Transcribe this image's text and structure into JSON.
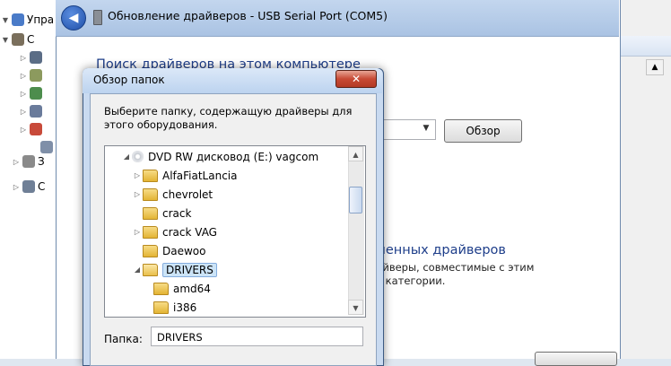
{
  "mmc": {
    "tree_items": [
      {
        "label": "Упра",
        "expander": "▼",
        "icon_color": "#4a7bc8"
      },
      {
        "label": "С",
        "expander": "▼",
        "icon_color": "#7a6f5c"
      },
      {
        "label": "",
        "expander": "▷",
        "icon_color": "#5b6d86"
      },
      {
        "label": "",
        "expander": "▷",
        "icon_color": "#8c9a5e"
      },
      {
        "label": "",
        "expander": "▷",
        "icon_color": "#4d8d4d"
      },
      {
        "label": "",
        "expander": "▷",
        "icon_color": "#6a7b9b"
      },
      {
        "label": "",
        "expander": "▷",
        "icon_color": "#c84a3a"
      },
      {
        "label": "",
        "expander": "",
        "icon_color": "#7f8fa8"
      },
      {
        "label": "З",
        "expander": "▷",
        "icon_color": "#8a8a8a"
      },
      {
        "label": "С",
        "expander": "▷",
        "icon_color": "#6f7f96"
      }
    ],
    "scroll_up_glyph": "▲"
  },
  "wizard": {
    "back_glyph": "◀",
    "title": "Обновление драйверов - USB Serial Port (COM5)",
    "heading": "Поиск драйверов на этом компьютере",
    "combo_arrow": "▼",
    "browse_button": "Обзор",
    "option2_title": "вленных драйверов",
    "option2_desc_1": "райверы, совместимые с этим",
    "option2_desc_2": "ке категории."
  },
  "dialog": {
    "title": "Обзор папок",
    "close_glyph": "✕",
    "description": "Выберите папку, содержащую драйверы для этого оборудования.",
    "tree": [
      {
        "label": "DVD RW дисковод (E:) vagcom",
        "expander": "◢",
        "kind": "disc",
        "level": 1
      },
      {
        "label": "AlfaFiatLancia",
        "expander": "▷",
        "kind": "folder",
        "level": 2
      },
      {
        "label": "chevrolet",
        "expander": "▷",
        "kind": "folder",
        "level": 2
      },
      {
        "label": "crack",
        "expander": "",
        "kind": "folder",
        "level": 2
      },
      {
        "label": "crack VAG",
        "expander": "▷",
        "kind": "folder",
        "level": 2
      },
      {
        "label": "Daewoo",
        "expander": "",
        "kind": "folder",
        "level": 2
      },
      {
        "label": "DRIVERS",
        "expander": "◢",
        "kind": "open-folder",
        "level": 2,
        "selected": true
      },
      {
        "label": "amd64",
        "expander": "",
        "kind": "folder",
        "level": 3
      },
      {
        "label": "i386",
        "expander": "",
        "kind": "folder",
        "level": 3
      }
    ],
    "scroll_up": "▲",
    "scroll_down": "▼",
    "folder_label": "Папка:",
    "folder_value": "DRIVERS"
  }
}
